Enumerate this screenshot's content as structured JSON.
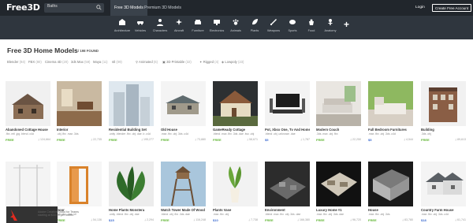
{
  "header": {
    "logo": "Free3D",
    "search_value": "Baths",
    "tabs": [
      "Free 3D Models",
      "Premium 3D Models"
    ],
    "login": "Login",
    "create_account": "Create Free Account"
  },
  "categories": [
    "Architecture",
    "Vehicles",
    "Characters",
    "Aircraft",
    "Furniture",
    "Electronics",
    "Animals",
    "Plants",
    "Weapons",
    "Sports",
    "Food",
    "Anatomy"
  ],
  "page": {
    "title": "Free 3D Home Models",
    "count": "/  198 FOUND"
  },
  "filters": [
    {
      "label": "Blender",
      "count": "(94)"
    },
    {
      "label": "FBX",
      "count": "(80)"
    },
    {
      "label": "Cinema 4D",
      "count": "(20)"
    },
    {
      "label": "3ds Max",
      "count": "(59)"
    },
    {
      "label": "Maya",
      "count": "(11)"
    },
    {
      "label": "stl",
      "count": "(09)"
    },
    {
      "label": "Animated",
      "count": "(6)"
    },
    {
      "label": "3D Printable",
      "count": "(32)"
    },
    {
      "label": "Rigged",
      "count": "(4)"
    },
    {
      "label": "Lowpoly",
      "count": "(23)"
    }
  ],
  "models": [
    {
      "title": "Abandoned Cottage House",
      "sub": ".fbx .mtl .jpg .blend .c4d",
      "price": "FREE",
      "dl": "124,664"
    },
    {
      "title": "Interior",
      "sub": ".obj .fbx .max .3ds",
      "price": "FREE",
      "dl": "22,735"
    },
    {
      "title": "Residential Building Set",
      "sub": ".unity .blender .fbx .obj .dae .b .c4d",
      "price": "FREE",
      "dl": "195,277"
    },
    {
      "title": "Old House",
      "sub": ".max .fbx .obj .3ds .c4d",
      "price": "FREE",
      "dl": "73,880"
    },
    {
      "title": "GameReady Cottage",
      "sub": ".blend .max .fbx .3ds .dae .lwo .obj",
      "price": "FREE",
      "dl": "58,671"
    },
    {
      "title": "Pot, Xbox One, Tv And Home Theater",
      "sub": ".blend .obj .unknown .dae",
      "price": "$5",
      "dl": "1,787"
    },
    {
      "title": "Modern Couch",
      "sub": ".3ds .max .obj .fbx",
      "price": "FREE",
      "dl": "22,250"
    },
    {
      "title": "Full Bedroom Furnitures",
      "sub": ".max .fbx .obj .3ds .c4d",
      "price": "$5",
      "dl": "4,544"
    },
    {
      "title": "Building",
      "sub": ".3ds .obj",
      "price": "FREE",
      "dl": "89,613"
    },
    {
      "title": "",
      "sub": "",
      "price": "",
      "dl": ""
    },
    {
      "title": "Door",
      "sub": ".obj .fbx .dae .stl",
      "price": "FREE",
      "dl": "54,136"
    },
    {
      "title": "Home Plants Monstera",
      "sub": ".unity .blend .fbx .obj .dae",
      "price": "$15",
      "dl": "2,294"
    },
    {
      "title": "Watch Tower Made Of Wood",
      "sub": ".blend .obj .fbx .3ds .dae",
      "price": "FREE",
      "dl": "116,248"
    },
    {
      "title": "Plants Vase",
      "sub": ".max .fbx .obj",
      "price": "$10",
      "dl": "7,738"
    },
    {
      "title": "Environment",
      "sub": ".blend .max .fbx .obj .3ds .dae",
      "price": "FREE",
      "dl": "166,380"
    },
    {
      "title": "Luxury Home #1",
      "sub": ".max .fbx .obj .3ds .dae",
      "price": "FREE",
      "dl": "96,720"
    },
    {
      "title": "House",
      "sub": ".max .fbx .obj .3ds",
      "price": "FREE",
      "dl": "83,780"
    },
    {
      "title": "Country Farm House",
      "sub": ".max .fbx .obj .3ds .c4d",
      "price": "$18",
      "dl": "61,741"
    }
  ],
  "ad": {
    "text": "Adobe Creative Cloud for Teams starting at $33.99 per month."
  }
}
